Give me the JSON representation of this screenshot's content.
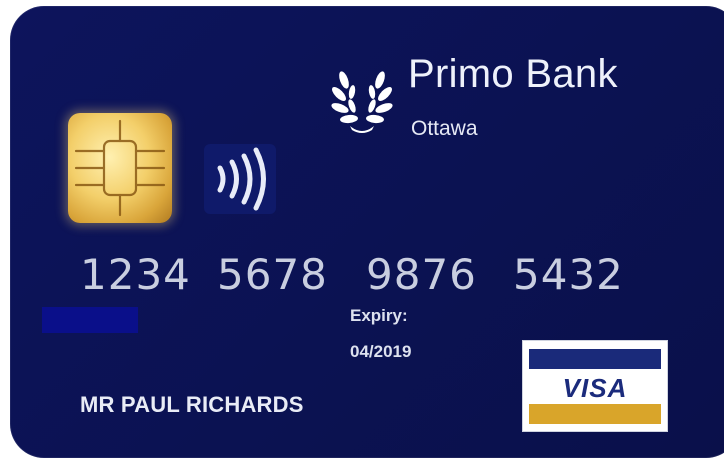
{
  "bank": {
    "name": "Primo Bank",
    "city": "Ottawa",
    "logo_icon": "laurel-wreath-icon"
  },
  "card": {
    "number_groups": [
      "1234",
      "5678",
      "9876",
      "5432"
    ],
    "expiry_label": "Expiry:",
    "expiry_value": "04/2019",
    "holder_name": "MR PAUL RICHARDS",
    "chip_icon": "emv-chip-icon",
    "contactless_icon": "contactless-icon"
  },
  "network": {
    "name": "VISA",
    "icon": "visa-logo-icon"
  },
  "colors": {
    "card_background": "#0b1252",
    "chip_gold": "#f3cf6a",
    "visa_blue": "#1a2a7a",
    "visa_gold": "#d9a52a"
  }
}
